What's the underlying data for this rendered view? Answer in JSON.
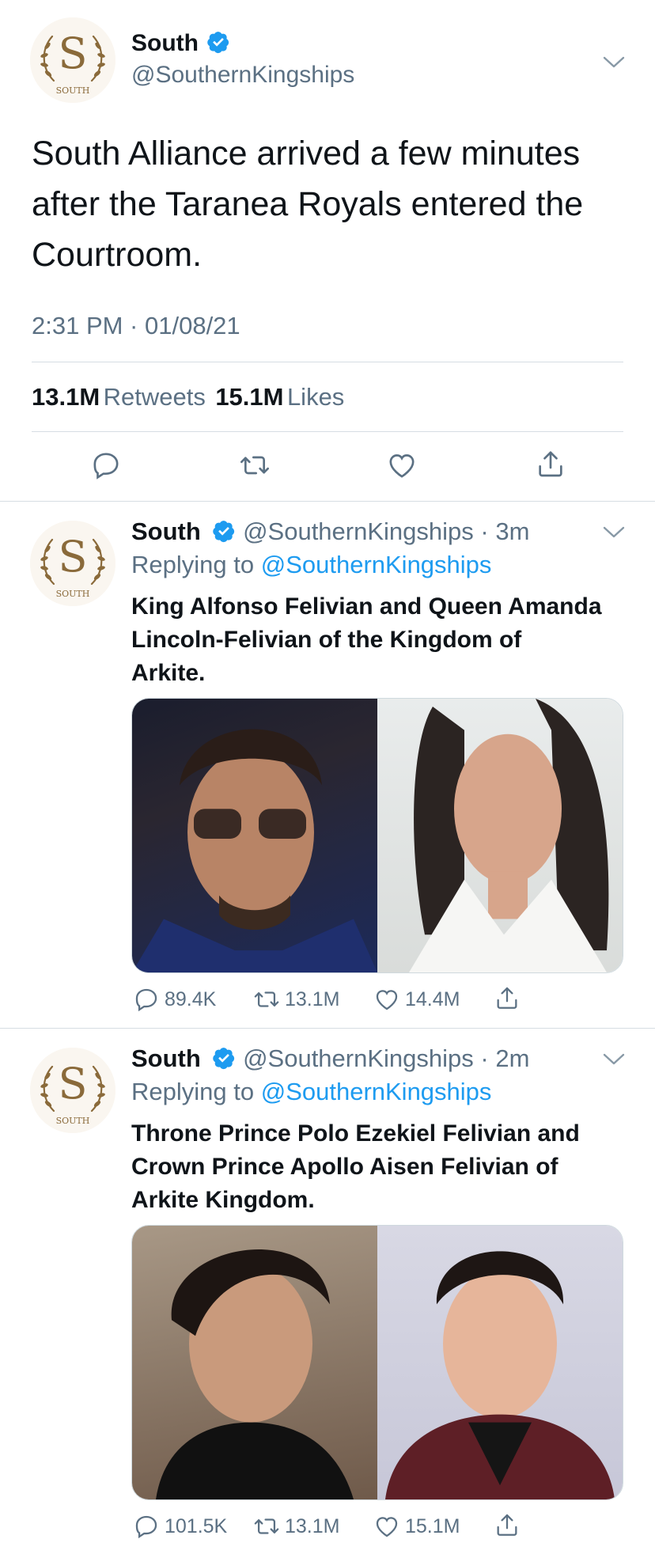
{
  "colors": {
    "text": "#0f1419",
    "secondary": "#5b7083",
    "accent": "#1d9bf0",
    "divider": "#d6dde3",
    "avatar_gold": "#8a6a3a"
  },
  "main_tweet": {
    "avatar": {
      "letter": "S",
      "caption": "SOUTH"
    },
    "name": "South",
    "handle": "@SouthernKingships",
    "text_lines": [
      "South Alliance arrived a few minutes",
      "after the Taranea Royals entered the",
      "Courtroom."
    ],
    "timestamp": "2:31 PM · 01/08/21",
    "retweets_count": "13.1M",
    "retweets_label": "Retweets",
    "likes_count": "15.1M",
    "likes_label": "Likes",
    "actions": [
      "reply-icon",
      "retweet-icon",
      "like-icon",
      "share-icon"
    ]
  },
  "replies": [
    {
      "avatar": {
        "letter": "S",
        "caption": "SOUTH"
      },
      "name": "South",
      "handle": "@SouthernKingships",
      "time": "· 3m",
      "replying_prefix": "Replying to",
      "replying_to": "@SouthernKingships",
      "text_lines": [
        "King Alfonso Felivian and Queen Amanda",
        "Lincoln-Felivian of the Kingdom of",
        "Arkite."
      ],
      "reply_count": "89.4K",
      "retweet_count": "13.1M",
      "like_count": "14.4M"
    },
    {
      "avatar": {
        "letter": "S",
        "caption": "SOUTH"
      },
      "name": "South",
      "handle": "@SouthernKingships",
      "time": "· 2m",
      "replying_prefix": "Replying to",
      "replying_to": "@SouthernKingships",
      "text_lines": [
        "Throne Prince Polo Ezekiel Felivian and",
        "Crown Prince Apollo Aisen Felivian of",
        "Arkite Kingdom."
      ],
      "reply_count": "101.5K",
      "retweet_count": "13.1M",
      "like_count": "15.1M"
    }
  ]
}
